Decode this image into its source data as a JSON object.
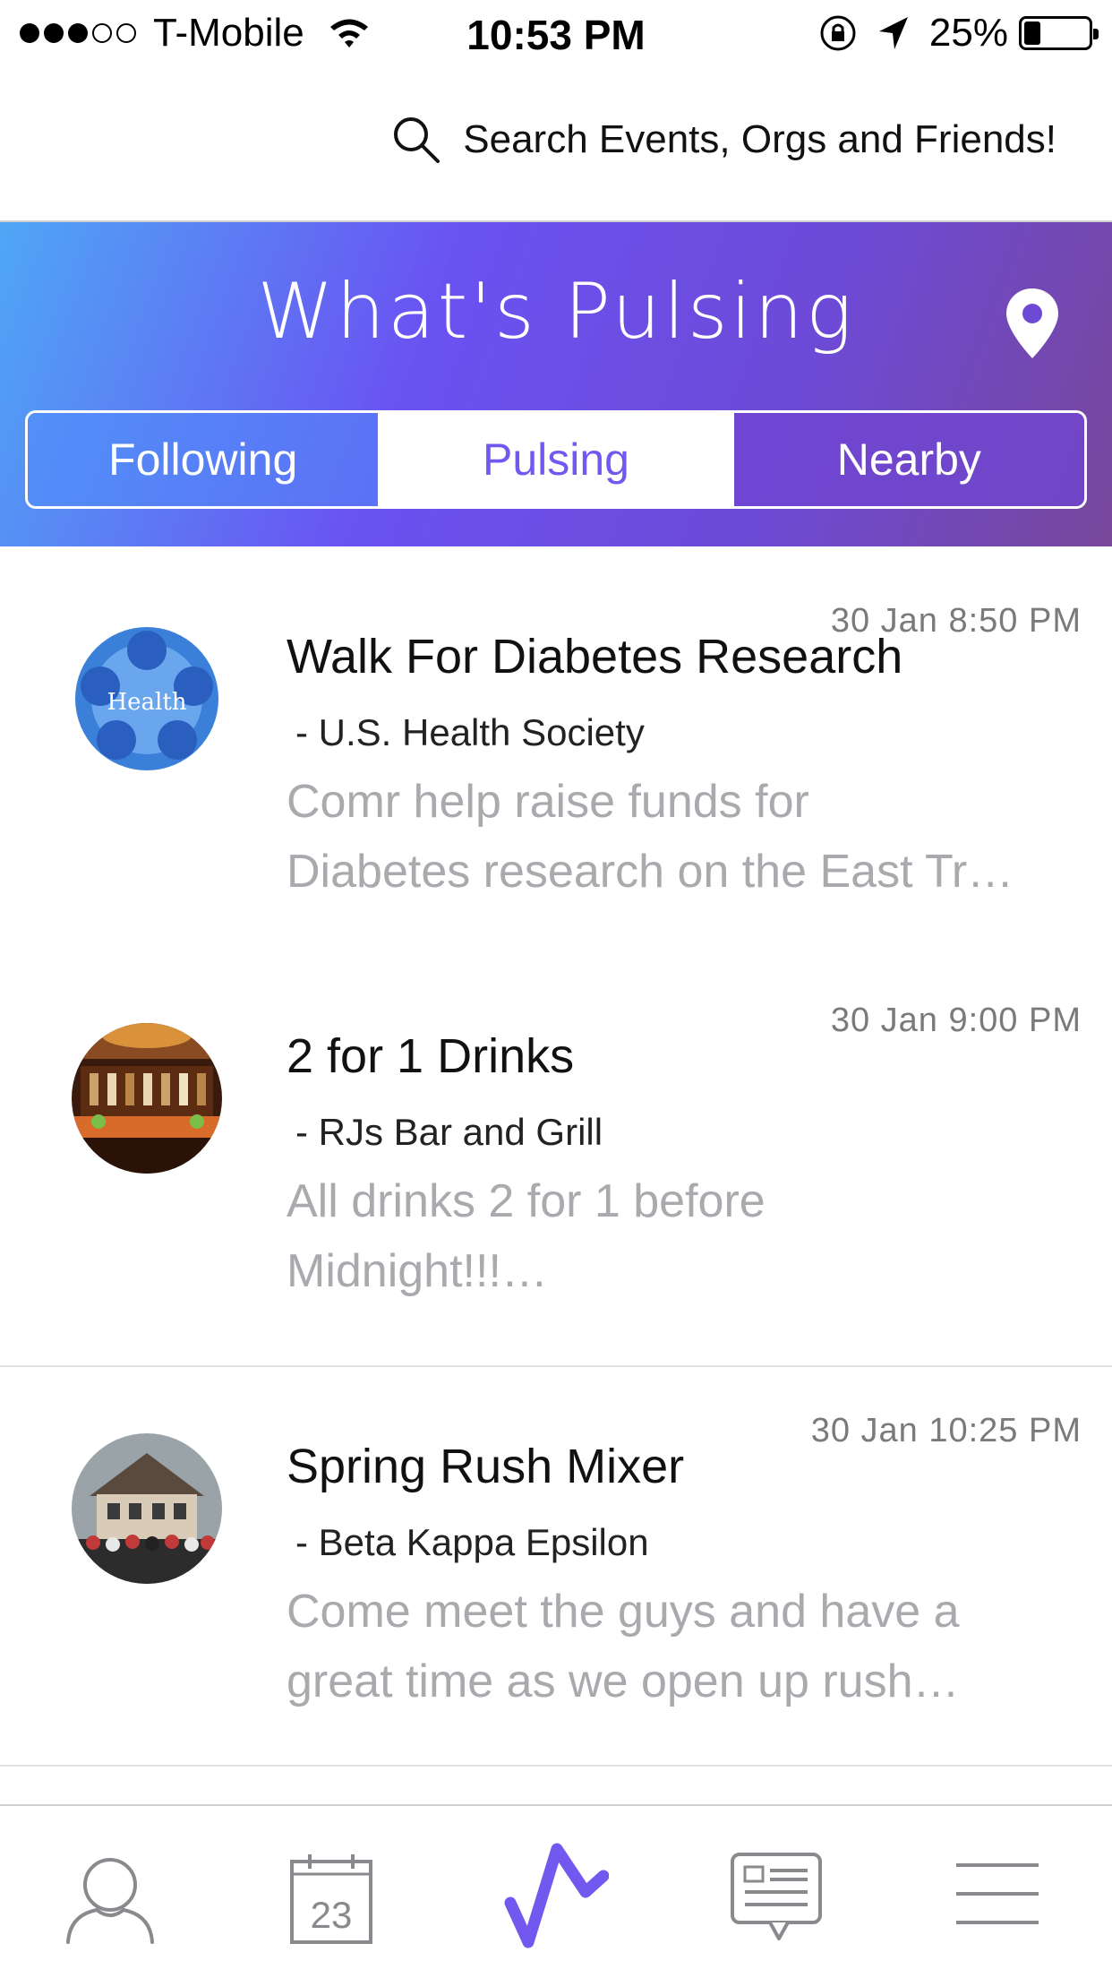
{
  "status_bar": {
    "carrier": "T-Mobile",
    "time": "10:53 PM",
    "battery": "25%",
    "battery_level": 0.25,
    "signal_bars": 3,
    "signal_total": 5
  },
  "search": {
    "placeholder": "Search Events, Orgs and Friends!"
  },
  "header": {
    "title": "What's Pulsing",
    "tabs": [
      {
        "label": "Following",
        "active": false
      },
      {
        "label": "Pulsing",
        "active": true
      },
      {
        "label": "Nearby",
        "active": false
      }
    ]
  },
  "events": [
    {
      "time": "30 Jan 8:50 PM",
      "title": "Walk For Diabetes Research",
      "org": "- U.S. Health Society",
      "desc_line1": "Comr help raise funds for",
      "desc_line2": "Diabetes research on the East Tr…",
      "avatar_label": "Health"
    },
    {
      "time": "30 Jan 9:00 PM",
      "title": "2 for 1 Drinks",
      "org": "- RJs Bar and Grill",
      "desc_line1": "All drinks 2 for 1 before",
      "desc_line2": "Midnight!!!…"
    },
    {
      "time": "30 Jan 10:25 PM",
      "title": "Spring Rush Mixer",
      "org": "- Beta Kappa Epsilon",
      "desc_line1": "Come meet the guys and have a",
      "desc_line2": "great time as we open up rush…"
    }
  ],
  "tab_bar": {
    "calendar_day": "23",
    "items": [
      "profile-icon",
      "calendar-icon",
      "pulse-icon",
      "messages-icon",
      "menu-icon"
    ],
    "accent": "#7358f0"
  },
  "colors": {
    "gradient_start": "#4fa7f6",
    "gradient_mid": "#6a52f2",
    "gradient_end": "#77479a",
    "accent": "#7358f0"
  }
}
